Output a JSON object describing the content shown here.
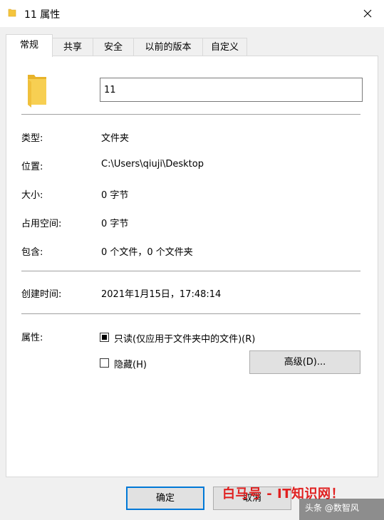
{
  "window": {
    "title": "11 属性",
    "close_glyph": "✕"
  },
  "tabs": [
    {
      "label": "常规",
      "active": true
    },
    {
      "label": "共享"
    },
    {
      "label": "安全"
    },
    {
      "label": "以前的版本"
    },
    {
      "label": "自定义"
    }
  ],
  "general": {
    "folder_name": "11",
    "type_label": "类型:",
    "type_value": "文件夹",
    "location_label": "位置:",
    "location_value": "C:\\Users\\qiuji\\Desktop",
    "size_label": "大小:",
    "size_value": "0 字节",
    "size_on_disk_label": "占用空间:",
    "size_on_disk_value": "0 字节",
    "contains_label": "包含:",
    "contains_value": "0 个文件，0 个文件夹",
    "created_label": "创建时间:",
    "created_value": "2021年1月15日，17:48:14",
    "attributes_label": "属性:",
    "readonly_label": "只读(仅应用于文件夹中的文件)(R)",
    "readonly_state": "indeterminate",
    "hidden_label": "隐藏(H)",
    "hidden_checked": false,
    "advanced_button": "高级(D)..."
  },
  "footer": {
    "ok": "确定",
    "cancel": "取消"
  },
  "watermarks": {
    "red_text": "白马号 - IT知识网！",
    "corner_text": "头条 @数智风"
  },
  "colors": {
    "accent": "#0078d7",
    "folder": "#f5c53d",
    "watermark_red": "#e02020"
  },
  "icons": {
    "title": "folder-icon",
    "close": "close-icon",
    "main": "folder-icon"
  }
}
